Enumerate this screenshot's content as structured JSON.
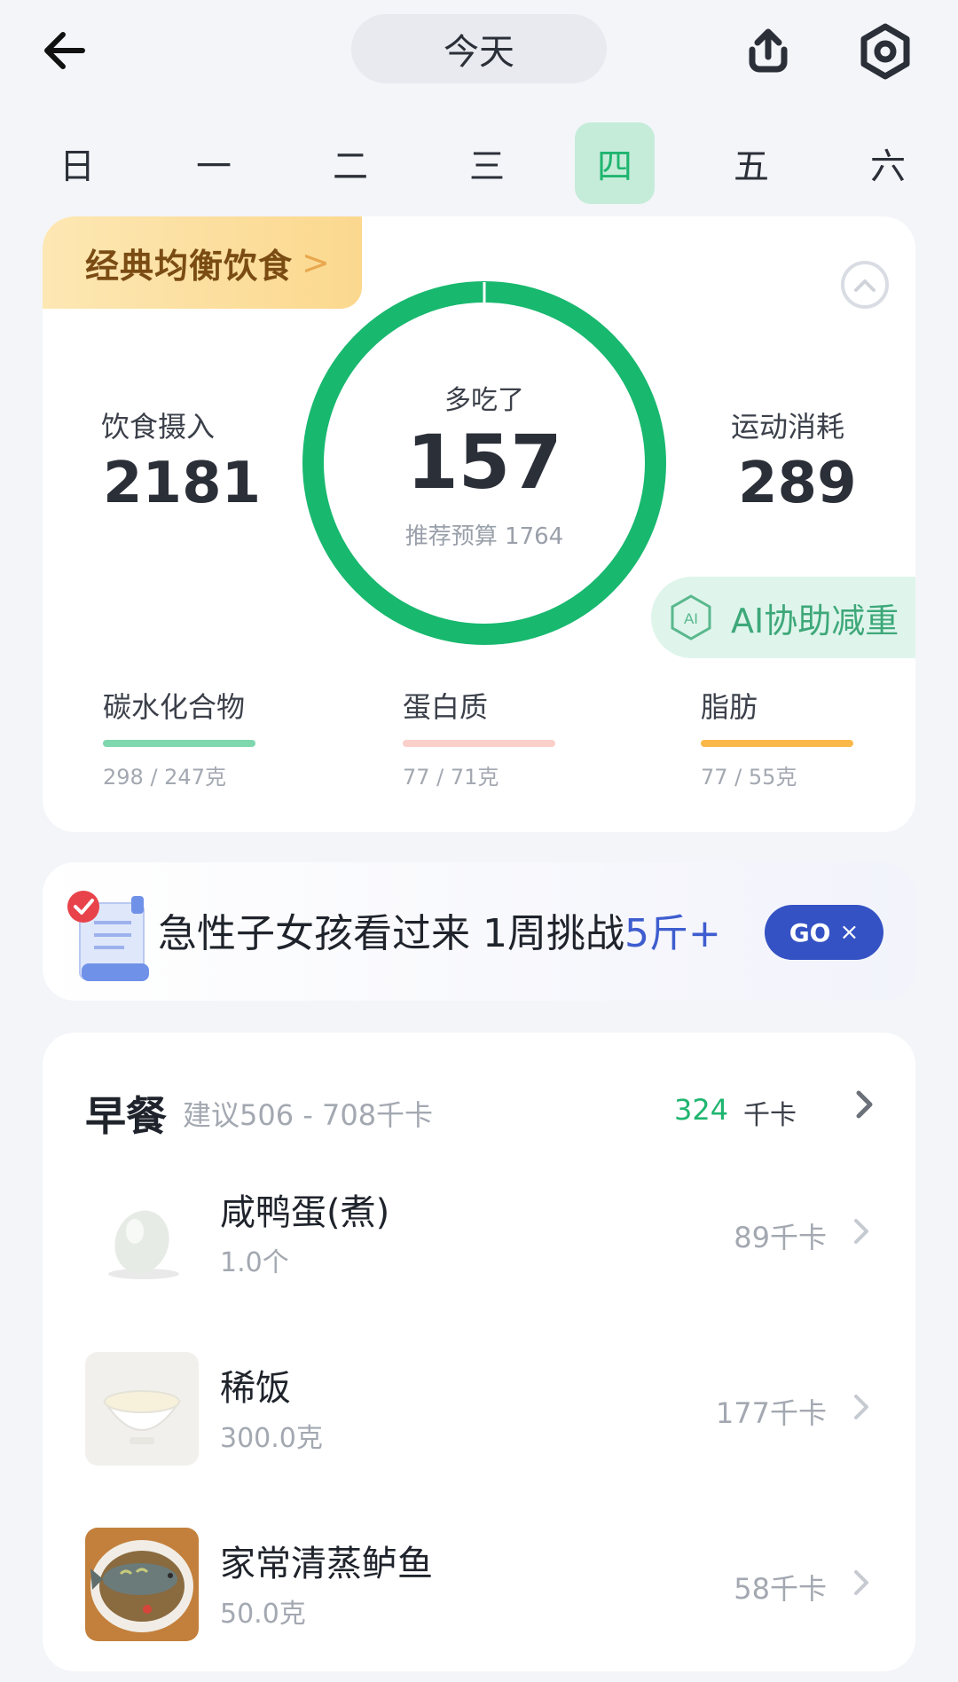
{
  "header": {
    "date_label": "今天"
  },
  "week": {
    "days": [
      "日",
      "一",
      "二",
      "三",
      "四",
      "五",
      "六"
    ],
    "active_index": 4
  },
  "summary": {
    "plan_label": "经典均衡饮食",
    "plan_chevron": ">",
    "intake_label": "饮食摄入",
    "intake_value": "2181",
    "ring_label": "多吃了",
    "ring_value": "157",
    "budget_text": "推荐预算 1764",
    "exercise_label": "运动消耗",
    "exercise_value": "289",
    "ai_label": "AI协助减重",
    "ai_icon_text": "AI",
    "macros": [
      {
        "label": "碳水化合物",
        "value": "298 / 247克",
        "color": "#7fd7ae"
      },
      {
        "label": "蛋白质",
        "value": "77 / 71克",
        "color": "#fbcfca"
      },
      {
        "label": "脂肪",
        "value": "77 / 55克",
        "color": "#fbb84a"
      }
    ],
    "ring_color": "#18b86f"
  },
  "promo": {
    "text": "急性子女孩看过来 1周挑战",
    "highlight": "5斤+",
    "button_label": "GO",
    "close_glyph": "×"
  },
  "breakfast": {
    "title": "早餐",
    "range": "建议506 - 708千卡",
    "kcal": "324",
    "unit": "千卡",
    "items": [
      {
        "name": "咸鸭蛋(煮)",
        "qty": "1.0个",
        "kcal": "89千卡",
        "icon": "egg"
      },
      {
        "name": "稀饭",
        "qty": "300.0克",
        "kcal": "177千卡",
        "icon": "porridge"
      },
      {
        "name": "家常清蒸鲈鱼",
        "qty": "50.0克",
        "kcal": "58千卡",
        "icon": "steamed-fish"
      }
    ]
  }
}
